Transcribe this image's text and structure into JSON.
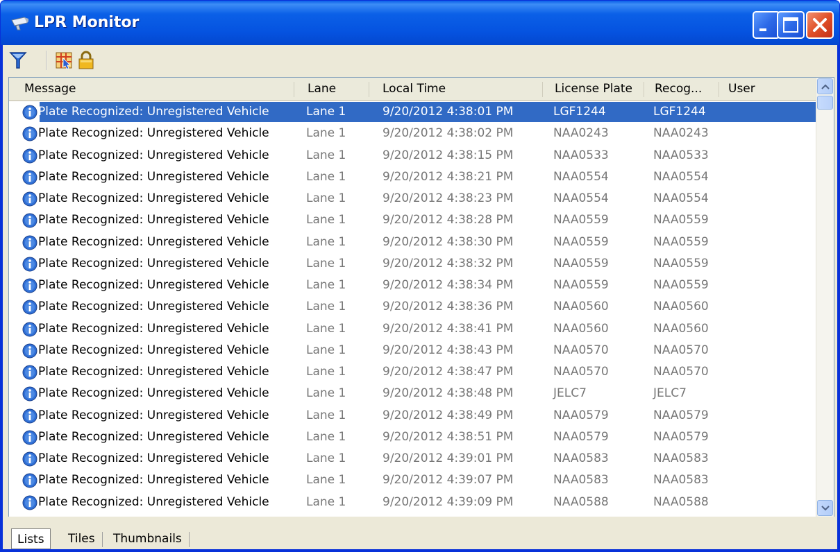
{
  "window": {
    "title": "LPR Monitor"
  },
  "toolbar": {
    "buttons": [
      "filter-icon",
      "map-select-icon",
      "lock-icon"
    ]
  },
  "columns": [
    "Message",
    "Lane",
    "Local Time",
    "License Plate",
    "Recog...",
    "User"
  ],
  "rows": [
    {
      "message": "Plate Recognized: Unregistered Vehicle",
      "lane": "Lane 1",
      "time": "9/20/2012 4:38:01 PM",
      "plate": "LGF1244",
      "recog": "LGF1244",
      "user": "",
      "selected": true
    },
    {
      "message": "Plate Recognized: Unregistered Vehicle",
      "lane": "Lane 1",
      "time": "9/20/2012 4:38:02 PM",
      "plate": "NAA0243",
      "recog": "NAA0243",
      "user": ""
    },
    {
      "message": "Plate Recognized: Unregistered Vehicle",
      "lane": "Lane 1",
      "time": "9/20/2012 4:38:15 PM",
      "plate": "NAA0533",
      "recog": "NAA0533",
      "user": ""
    },
    {
      "message": "Plate Recognized: Unregistered Vehicle",
      "lane": "Lane 1",
      "time": "9/20/2012 4:38:21 PM",
      "plate": "NAA0554",
      "recog": "NAA0554",
      "user": ""
    },
    {
      "message": "Plate Recognized: Unregistered Vehicle",
      "lane": "Lane 1",
      "time": "9/20/2012 4:38:23 PM",
      "plate": "NAA0554",
      "recog": "NAA0554",
      "user": ""
    },
    {
      "message": "Plate Recognized: Unregistered Vehicle",
      "lane": "Lane 1",
      "time": "9/20/2012 4:38:28 PM",
      "plate": "NAA0559",
      "recog": "NAA0559",
      "user": ""
    },
    {
      "message": "Plate Recognized: Unregistered Vehicle",
      "lane": "Lane 1",
      "time": "9/20/2012 4:38:30 PM",
      "plate": "NAA0559",
      "recog": "NAA0559",
      "user": ""
    },
    {
      "message": "Plate Recognized: Unregistered Vehicle",
      "lane": "Lane 1",
      "time": "9/20/2012 4:38:32 PM",
      "plate": "NAA0559",
      "recog": "NAA0559",
      "user": ""
    },
    {
      "message": "Plate Recognized: Unregistered Vehicle",
      "lane": "Lane 1",
      "time": "9/20/2012 4:38:34 PM",
      "plate": "NAA0559",
      "recog": "NAA0559",
      "user": ""
    },
    {
      "message": "Plate Recognized: Unregistered Vehicle",
      "lane": "Lane 1",
      "time": "9/20/2012 4:38:36 PM",
      "plate": "NAA0560",
      "recog": "NAA0560",
      "user": ""
    },
    {
      "message": "Plate Recognized: Unregistered Vehicle",
      "lane": "Lane 1",
      "time": "9/20/2012 4:38:41 PM",
      "plate": "NAA0560",
      "recog": "NAA0560",
      "user": ""
    },
    {
      "message": "Plate Recognized: Unregistered Vehicle",
      "lane": "Lane 1",
      "time": "9/20/2012 4:38:43 PM",
      "plate": "NAA0570",
      "recog": "NAA0570",
      "user": ""
    },
    {
      "message": "Plate Recognized: Unregistered Vehicle",
      "lane": "Lane 1",
      "time": "9/20/2012 4:38:47 PM",
      "plate": "NAA0570",
      "recog": "NAA0570",
      "user": ""
    },
    {
      "message": "Plate Recognized: Unregistered Vehicle",
      "lane": "Lane 1",
      "time": "9/20/2012 4:38:48 PM",
      "plate": "JELC7",
      "recog": "JELC7",
      "user": ""
    },
    {
      "message": "Plate Recognized: Unregistered Vehicle",
      "lane": "Lane 1",
      "time": "9/20/2012 4:38:49 PM",
      "plate": "NAA0579",
      "recog": "NAA0579",
      "user": ""
    },
    {
      "message": "Plate Recognized: Unregistered Vehicle",
      "lane": "Lane 1",
      "time": "9/20/2012 4:38:51 PM",
      "plate": "NAA0579",
      "recog": "NAA0579",
      "user": ""
    },
    {
      "message": "Plate Recognized: Unregistered Vehicle",
      "lane": "Lane 1",
      "time": "9/20/2012 4:39:01 PM",
      "plate": "NAA0583",
      "recog": "NAA0583",
      "user": ""
    },
    {
      "message": "Plate Recognized: Unregistered Vehicle",
      "lane": "Lane 1",
      "time": "9/20/2012 4:39:07 PM",
      "plate": "NAA0583",
      "recog": "NAA0583",
      "user": ""
    },
    {
      "message": "Plate Recognized: Unregistered Vehicle",
      "lane": "Lane 1",
      "time": "9/20/2012 4:39:09 PM",
      "plate": "NAA0588",
      "recog": "NAA0588",
      "user": ""
    }
  ],
  "view_tabs": [
    {
      "label": "Lists",
      "active": true
    },
    {
      "label": "Tiles",
      "active": false
    },
    {
      "label": "Thumbnails",
      "active": false
    }
  ],
  "colors": {
    "selection": "#316ac5",
    "titlebar": "#0553e0",
    "close_button": "#e05028",
    "chrome": "#ece9d8"
  }
}
